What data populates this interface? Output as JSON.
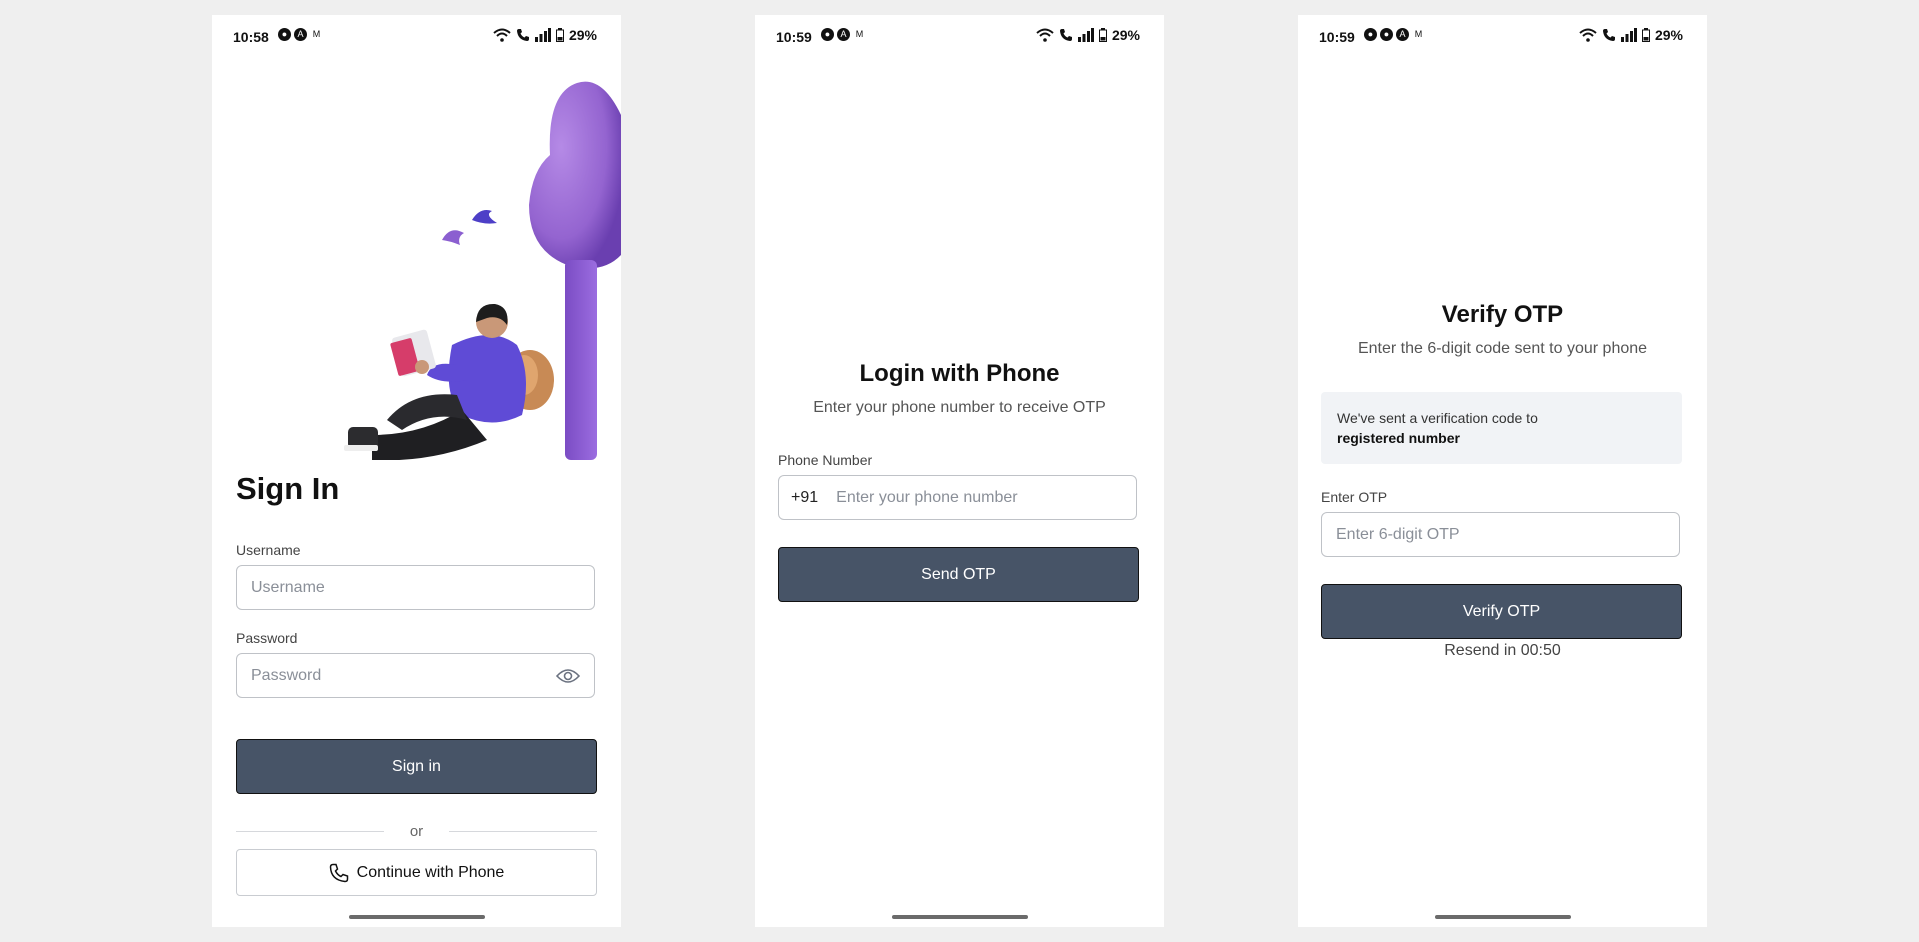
{
  "screens": [
    {
      "status": {
        "time": "10:58",
        "battery": "29%"
      },
      "title": "Sign In",
      "username_label": "Username",
      "username_placeholder": "Username",
      "password_label": "Password",
      "password_placeholder": "Password",
      "signin_label": "Sign in",
      "divider_label": "or",
      "phone_button_label": "Continue with Phone"
    },
    {
      "status": {
        "time": "10:59",
        "battery": "29%"
      },
      "title": "Login with Phone",
      "subtitle": "Enter your phone number to receive OTP",
      "phone_label": "Phone Number",
      "country_code": "+91",
      "phone_placeholder": "Enter your phone number",
      "send_label": "Send OTP"
    },
    {
      "status": {
        "time": "10:59",
        "battery": "29%"
      },
      "title": "Verify OTP",
      "subtitle": "Enter the 6-digit code sent to your phone",
      "info_line1": "We've sent a verification code to",
      "info_line2": "registered number",
      "otp_label": "Enter OTP",
      "otp_placeholder": "Enter 6-digit OTP",
      "verify_label": "Verify OTP",
      "resend_text": "Resend in 00:50"
    }
  ],
  "colors": {
    "primary_button": "#475467",
    "background": "#efefef",
    "info_box": "#f1f3f6",
    "illustration_purple": "#9a6fd3"
  }
}
